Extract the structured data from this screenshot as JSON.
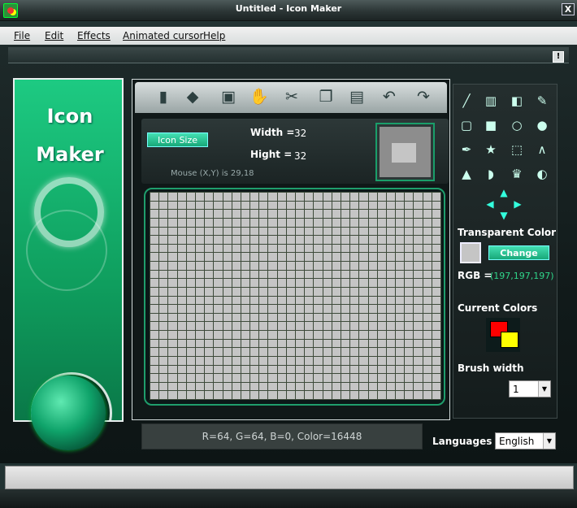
{
  "window": {
    "title": "Untitled - Icon Maker",
    "close_label": "X"
  },
  "menu": {
    "items": [
      {
        "label": "File"
      },
      {
        "label": "Edit"
      },
      {
        "label": "Effects"
      },
      {
        "label": "Animated cursor"
      },
      {
        "label": "Help"
      }
    ],
    "info_label": "!"
  },
  "banner": {
    "line1": "Icon",
    "line2": "Maker"
  },
  "toolbar": {
    "tools": [
      {
        "name": "new-file-icon",
        "glyph": "▮"
      },
      {
        "name": "open-book-icon",
        "glyph": "◆"
      },
      {
        "name": "save-icon",
        "glyph": "▣"
      },
      {
        "name": "hand-icon",
        "glyph": "✋"
      },
      {
        "name": "cut-icon",
        "glyph": "✂"
      },
      {
        "name": "copy-icon",
        "glyph": "❐"
      },
      {
        "name": "paste-icon",
        "glyph": "▤"
      },
      {
        "name": "undo-icon",
        "glyph": "↶"
      },
      {
        "name": "redo-icon",
        "glyph": "↷"
      }
    ]
  },
  "canvas": {
    "icon_size_label": "Icon Size",
    "width_label": "Width =",
    "width_value": "32",
    "height_label": "Hight =",
    "height_value": "32",
    "mouse_status": "Mouse (X,Y) is 29,18",
    "grid_cols": 32,
    "grid_rows": 24,
    "pixel_color": "#c5c5c5",
    "grid_line_color": "#3d4a3a"
  },
  "drawing_tools": [
    {
      "name": "line-tool-icon",
      "glyph": "╱"
    },
    {
      "name": "bucket-tool-icon",
      "glyph": "▥"
    },
    {
      "name": "eraser-tool-icon",
      "glyph": "◧"
    },
    {
      "name": "pencil-tool-icon",
      "glyph": "✎"
    },
    {
      "name": "rect-outline-tool-icon",
      "glyph": "▢"
    },
    {
      "name": "rect-fill-tool-icon",
      "glyph": "■"
    },
    {
      "name": "ellipse-outline-tool-icon",
      "glyph": "○"
    },
    {
      "name": "ellipse-fill-tool-icon",
      "glyph": "●"
    },
    {
      "name": "color-picker-tool-icon",
      "glyph": "✒"
    },
    {
      "name": "star-tool-icon",
      "glyph": "★"
    },
    {
      "name": "select-tool-icon",
      "glyph": "⬚"
    },
    {
      "name": "curve-tool-icon",
      "glyph": "∧"
    },
    {
      "name": "cone-tool-icon",
      "glyph": "▲"
    },
    {
      "name": "drop-tool-icon",
      "glyph": "◗"
    },
    {
      "name": "stamp-tool-icon",
      "glyph": "♛"
    },
    {
      "name": "sphere-tool-icon",
      "glyph": "◐"
    }
  ],
  "arrows": [
    {
      "name": "arrow-up-icon",
      "glyph": "▲"
    },
    {
      "name": "arrow-left-icon",
      "glyph": "◀"
    },
    {
      "name": "arrow-right-icon",
      "glyph": "▶"
    },
    {
      "name": "arrow-down-icon",
      "glyph": "▼"
    }
  ],
  "transparent_color": {
    "label": "Transparent Color",
    "change_label": "Change",
    "rgb_label": "RGB =",
    "rgb_value": "(197,197,197)",
    "swatch_color": "#c5c5c5"
  },
  "current_colors": {
    "label": "Current Colors",
    "primary": "#ff0000",
    "secondary": "#ffff00"
  },
  "brush": {
    "label": "Brush width",
    "value": "1"
  },
  "color_readout": "R=64, G=64, B=0, Color=16448",
  "language": {
    "label": "Languages",
    "value": "English"
  }
}
